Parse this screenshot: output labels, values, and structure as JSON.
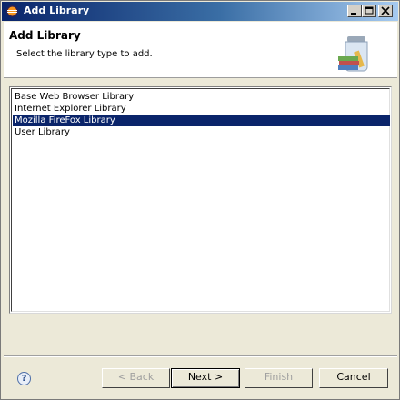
{
  "window": {
    "title": "Add Library"
  },
  "banner": {
    "title": "Add Library",
    "message": "Select the library type to add."
  },
  "library_types": [
    {
      "label": "Base Web Browser Library",
      "selected": false
    },
    {
      "label": "Internet Explorer Library",
      "selected": false
    },
    {
      "label": "Mozilla FireFox Library",
      "selected": true
    },
    {
      "label": "User Library",
      "selected": false
    }
  ],
  "buttons": {
    "help_label": "?",
    "back_label": "< Back",
    "next_label": "Next >",
    "finish_label": "Finish",
    "cancel_label": "Cancel"
  },
  "colors": {
    "title_bar": "#0a246a",
    "selection": "#0a246a",
    "dialog_bg": "#ece9d8"
  },
  "icons": {
    "app": "eclipse-icon",
    "banner": "library-jar-icon"
  }
}
